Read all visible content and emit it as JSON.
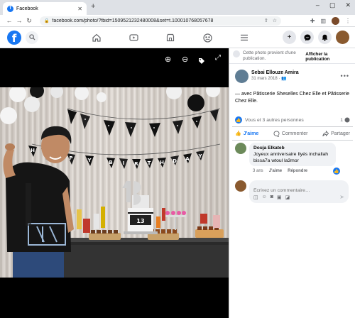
{
  "browser": {
    "tab_title": "Facebook",
    "tab_favicon": "f",
    "new_tab": "+",
    "url": "facebook.com/photo/?fbid=1509521232480008&set=t.100010768057678",
    "window_controls": {
      "minimize": "–",
      "maximize": "▢",
      "close": "✕"
    }
  },
  "fb": {
    "logo": "f",
    "accent": "#1877f2"
  },
  "photo_controls": {
    "zoom_in": "⊕",
    "zoom_out": "⊖",
    "tag": "🏷",
    "fullscreen": "⤢"
  },
  "banner_letters": [
    "H",
    "A",
    "P",
    "P",
    "Y",
    "B",
    "I",
    "R",
    "T",
    "H",
    "D",
    "A",
    "Y"
  ],
  "cake_number": "13",
  "notice": {
    "text": "Cette photo provient d'une publication.",
    "button": "Afficher la publication"
  },
  "post": {
    "author": "Sebai Ellouze Amira",
    "date": "31 mars 2018 ·",
    "caption": "— avec Pâtisserie Sheselles Chez Elle et Pâtisserie Chez Elle.",
    "reactions": "Vous et 3 autres personnes",
    "comment_count": "1"
  },
  "actions": {
    "like": "J'aime",
    "comment": "Commenter",
    "share": "Partager"
  },
  "comment": {
    "author": "Douja Elkateb",
    "text": "Joyeux anniversaire Ilyés inchallah bissa7a wtoul la3mor",
    "age": "3 ans",
    "like": "J'aime",
    "reply": "Répondre"
  },
  "composer": {
    "placeholder": "Écrivez un commentaire…"
  }
}
